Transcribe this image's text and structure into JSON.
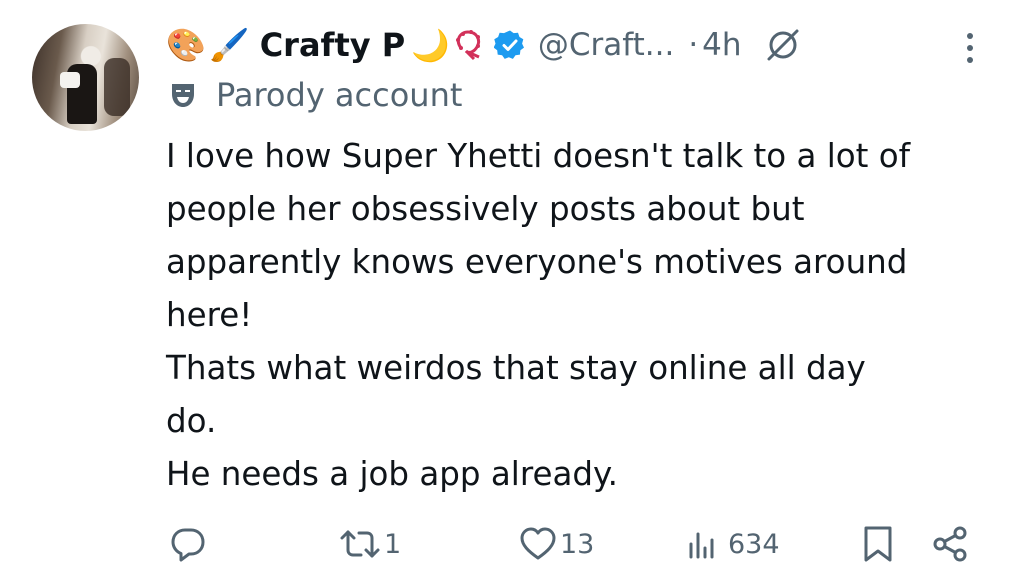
{
  "post": {
    "display_name": "Crafty P",
    "handle": "@Craft...",
    "separator": "·",
    "time": "4h",
    "emojis_before_name": [
      "🎨",
      "🖌️"
    ],
    "emoji_after_name": "🌙",
    "label_icon": "theater-mask-icon",
    "label": "Parody account",
    "text_lines": [
      "I love how Super Yhetti doesn't talk to a lot of",
      "people her obsessively posts about but",
      "apparently knows everyone's motives around",
      "here!",
      "Thats what weirdos that stay online all day",
      "do.",
      "He needs a job app already."
    ]
  },
  "actions": {
    "replies": "",
    "reposts": "1",
    "likes": "13",
    "views": "634"
  },
  "colors": {
    "text": "#0f1419",
    "secondary": "#536471",
    "verified": "#1d9bf0",
    "beads": "#d2315a"
  }
}
